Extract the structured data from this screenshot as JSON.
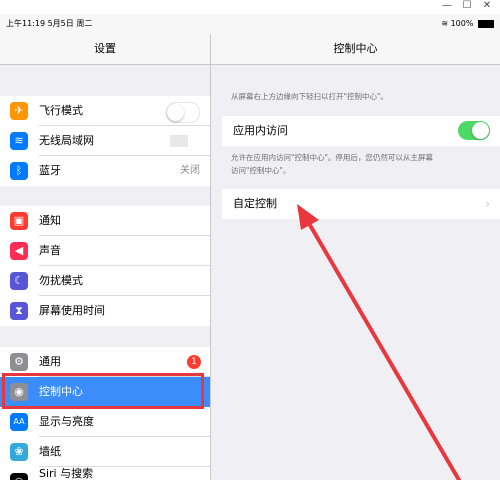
{
  "status": {
    "time_date": "上午11:19  5月5日 周二",
    "battery": "100%"
  },
  "sidebar": {
    "title": "设置",
    "items": [
      {
        "label": "飞行模式",
        "icon": "airplane-icon",
        "color": "#ff9500",
        "glyph": "✈"
      },
      {
        "label": "无线局域网",
        "icon": "wifi-icon",
        "color": "#007aff",
        "glyph": "≋"
      },
      {
        "label": "蓝牙",
        "icon": "bluetooth-icon",
        "color": "#007aff",
        "glyph": "ᛒ",
        "value": "关闭"
      },
      {
        "label": "通知",
        "icon": "notifications-icon",
        "color": "#ff3b30",
        "glyph": "▣"
      },
      {
        "label": "声音",
        "icon": "sound-icon",
        "color": "#ff2d55",
        "glyph": "◀"
      },
      {
        "label": "勿扰模式",
        "icon": "moon-icon",
        "color": "#5856d6",
        "glyph": "☾"
      },
      {
        "label": "屏幕使用时间",
        "icon": "hourglass-icon",
        "color": "#5856d6",
        "glyph": "⧗"
      },
      {
        "label": "通用",
        "icon": "gear-icon",
        "color": "#8e8e93",
        "glyph": "⚙",
        "badge": "1"
      },
      {
        "label": "控制中心",
        "icon": "toggles-icon",
        "color": "#8e8e93",
        "glyph": "◉"
      },
      {
        "label": "显示与亮度",
        "icon": "display-icon",
        "color": "#007aff",
        "glyph": "AA"
      },
      {
        "label": "墙纸",
        "icon": "wallpaper-icon",
        "color": "#34aadc",
        "glyph": "❀"
      },
      {
        "label": "Siri 与搜索",
        "icon": "siri-icon",
        "color": "#000000",
        "glyph": "◎"
      }
    ]
  },
  "detail": {
    "title": "控制中心",
    "intro": "从屏幕右上方边缘向下轻扫以打开\"控制中心\"。",
    "access_label": "应用内访问",
    "access_desc_1": "允许在应用内访问\"控制中心\"。停用后，您仍然可以从主屏幕",
    "access_desc_2": "访问\"控制中心\"。",
    "customize_label": "自定控制"
  },
  "colors": {
    "accent": "#3a8dfb",
    "toggle_on": "#4cd964",
    "annotation": "#e8383d"
  }
}
